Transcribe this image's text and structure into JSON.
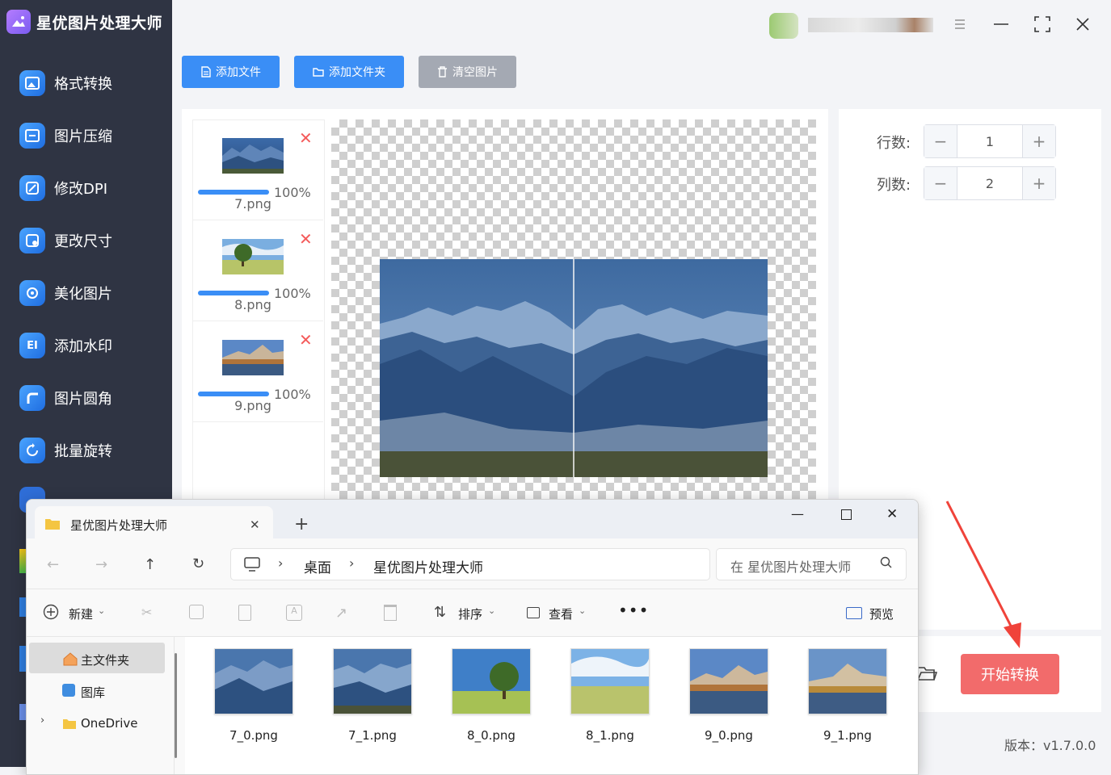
{
  "app": {
    "title": "星优图片处理大师",
    "version": "版本：v1.7.0.0"
  },
  "sidebar": {
    "items": [
      {
        "label": "格式转换",
        "icon": "image-convert-icon"
      },
      {
        "label": "图片压缩",
        "icon": "image-compress-icon"
      },
      {
        "label": "修改DPI",
        "icon": "dpi-icon"
      },
      {
        "label": "更改尺寸",
        "icon": "resize-icon"
      },
      {
        "label": "美化图片",
        "icon": "beautify-icon"
      },
      {
        "label": "添加水印",
        "icon": "watermark-icon"
      },
      {
        "label": "图片圆角",
        "icon": "round-corner-icon"
      },
      {
        "label": "批量旋转",
        "icon": "rotate-icon"
      }
    ]
  },
  "toolbar": {
    "add_file": "添加文件",
    "add_folder": "添加文件夹",
    "clear": "清空图片",
    "colors": {
      "primary": "#3a8ef6",
      "gray": "#a4a9b3",
      "start": "#f26b6b"
    }
  },
  "files": [
    {
      "name": "7.png",
      "progress": "100%"
    },
    {
      "name": "8.png",
      "progress": "100%"
    },
    {
      "name": "9.png",
      "progress": "100%"
    }
  ],
  "settings": {
    "rows_label": "行数:",
    "rows_value": "1",
    "cols_label": "列数:",
    "cols_value": "2"
  },
  "start_button": "开始转换",
  "explorer": {
    "tab_title": "星优图片处理大师",
    "breadcrumb": [
      "桌面",
      "星优图片处理大师"
    ],
    "search_placeholder": "在 星优图片处理大师",
    "commands": {
      "new": "新建",
      "sort": "排序",
      "view": "查看",
      "preview": "预览"
    },
    "nav": [
      "主文件夹",
      "图库",
      "OneDrive"
    ],
    "files": [
      "7_0.png",
      "7_1.png",
      "8_0.png",
      "8_1.png",
      "9_0.png",
      "9_1.png"
    ]
  }
}
